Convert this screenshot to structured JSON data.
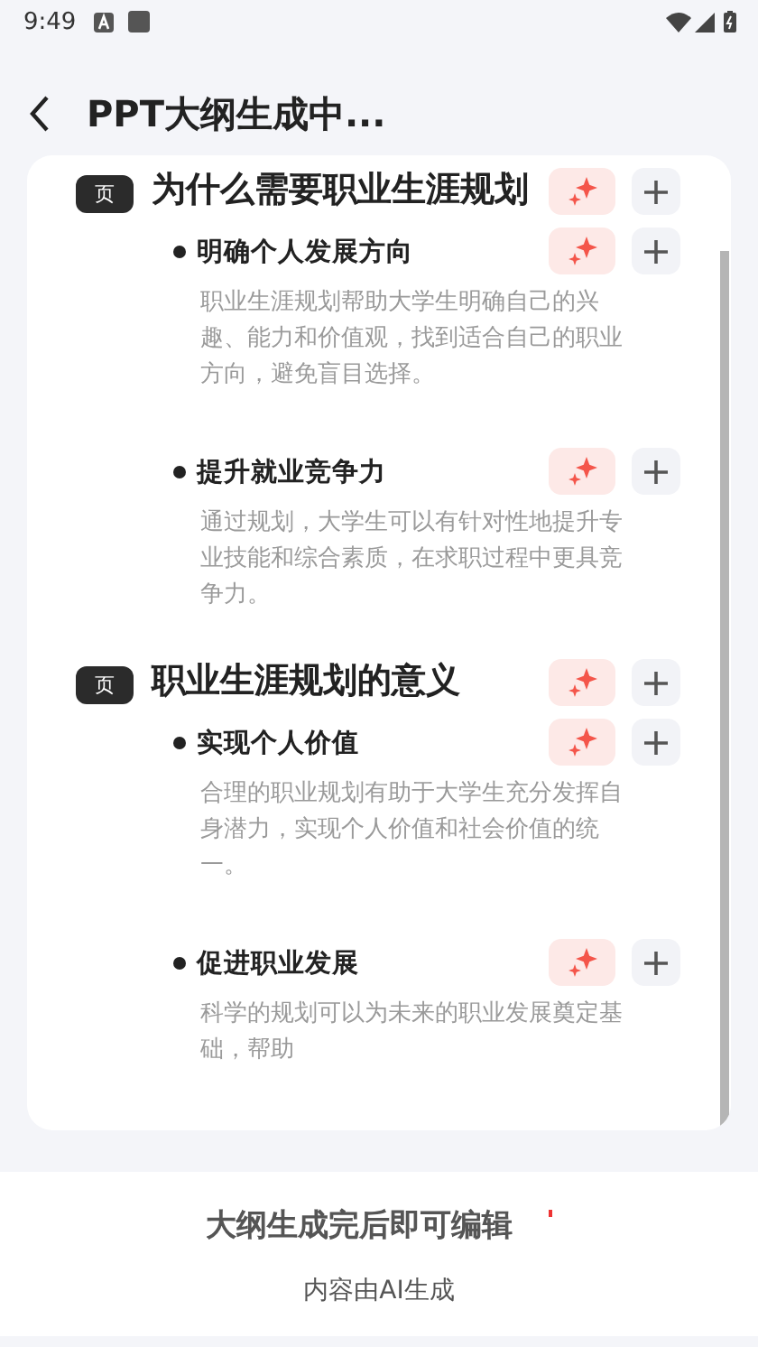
{
  "status_bar": {
    "time": "9:49"
  },
  "header": {
    "title": "PPT大纲生成中..."
  },
  "outline": [
    {
      "badge": "页",
      "title": "为什么需要职业生涯规划",
      "points": [
        {
          "title": "明确个人发展方向",
          "text": "职业生涯规划帮助大学生明确自己的兴趣、能力和价值观，找到适合自己的职业方向，避免盲目选择。"
        },
        {
          "title": "提升就业竞争力",
          "text": "通过规划，大学生可以有针对性地提升专业技能和综合素质，在求职过程中更具竞争力。"
        }
      ]
    },
    {
      "badge": "页",
      "title": "职业生涯规划的意义",
      "points": [
        {
          "title": "实现个人价值",
          "text": "合理的职业规划有助于大学生充分发挥自身潜力，实现个人价值和社会价值的统一。"
        },
        {
          "title": "促进职业发展",
          "text": "科学的规划可以为未来的职业发展奠定基础，帮助"
        }
      ]
    }
  ],
  "footer": {
    "notice": "大纲生成完后即可编辑",
    "disclaimer": "内容由AI生成"
  }
}
